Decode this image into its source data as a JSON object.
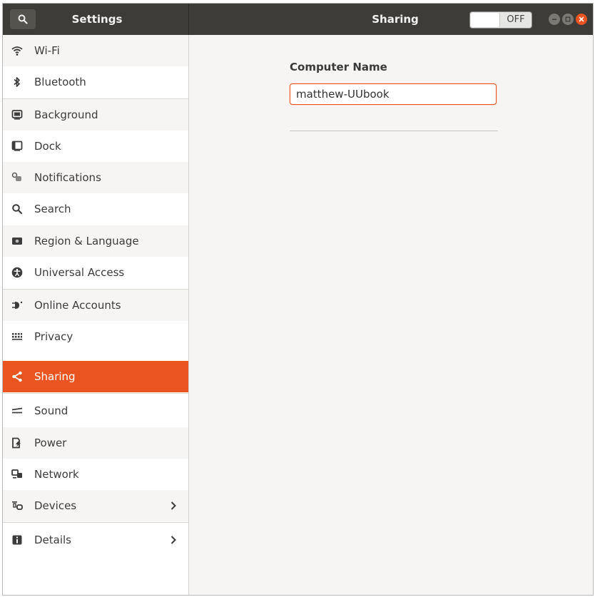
{
  "header": {
    "app_title": "Settings",
    "panel_title": "Sharing",
    "sharing_toggle": "OFF"
  },
  "sidebar": {
    "items": [
      {
        "label": "Wi-Fi",
        "icon": "wifi-icon"
      },
      {
        "label": "Bluetooth",
        "icon": "bluetooth-icon"
      },
      {
        "label": "Background",
        "icon": "background-icon"
      },
      {
        "label": "Dock",
        "icon": "dock-icon"
      },
      {
        "label": "Notifications",
        "icon": "notifications-icon"
      },
      {
        "label": "Search",
        "icon": "search-icon"
      },
      {
        "label": "Region & Language",
        "icon": "region-icon"
      },
      {
        "label": "Universal Access",
        "icon": "universal-access-icon"
      },
      {
        "label": "Online Accounts",
        "icon": "online-accounts-icon"
      },
      {
        "label": "Privacy",
        "icon": "privacy-icon"
      },
      {
        "label": "Sharing",
        "icon": "share-icon"
      },
      {
        "label": "Sound",
        "icon": "sound-icon"
      },
      {
        "label": "Power",
        "icon": "power-icon"
      },
      {
        "label": "Network",
        "icon": "network-icon"
      },
      {
        "label": "Devices",
        "icon": "devices-icon"
      },
      {
        "label": "Details",
        "icon": "details-icon"
      }
    ],
    "active": "Sharing"
  },
  "main": {
    "computer_name_label": "Computer Name",
    "computer_name_value": "matthew-UUbook"
  },
  "colors": {
    "accent": "#e95420",
    "header_bg": "#3d3c38",
    "panel_bg": "#f6f5f4"
  }
}
